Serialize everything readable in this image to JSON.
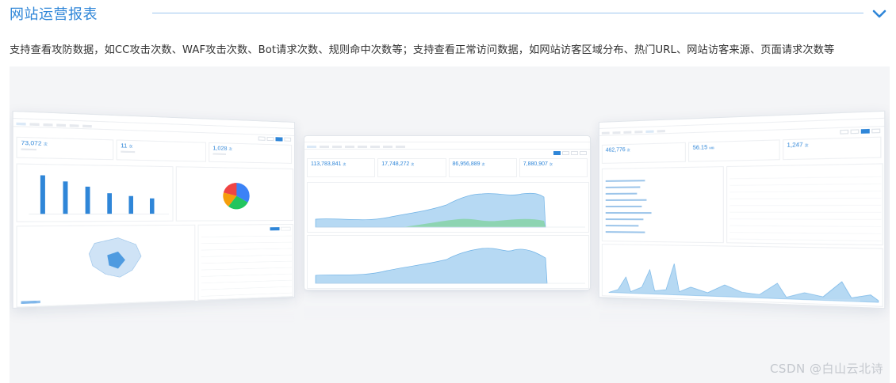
{
  "section": {
    "title": "网站运营报表",
    "description": "支持查看攻防数据，如CC攻击次数、WAF攻击次数、Bot请求次数、规则命中次数等；支持查看正常访问数据，如网站访客区域分布、热门URL、网站访客来源、页面请求次数等",
    "collapse_icon": "chevron-down-icon"
  },
  "left_card": {
    "stats": [
      {
        "value": "73,072",
        "unit": "次"
      },
      {
        "value": "11",
        "unit": "次"
      },
      {
        "value": "1,028",
        "unit": "次"
      }
    ],
    "bar_values": [
      100,
      85,
      72,
      55,
      48,
      42
    ]
  },
  "center_card": {
    "stats": [
      {
        "value": "113,783,841",
        "unit": "次"
      },
      {
        "value": "17,748,272",
        "unit": "次"
      },
      {
        "value": "86,956,889",
        "unit": "次"
      },
      {
        "value": "7,880,907",
        "unit": "次"
      }
    ]
  },
  "right_card": {
    "stats": [
      {
        "value": "462,776",
        "unit": "次"
      },
      {
        "value": "56.15",
        "unit": "MB"
      },
      {
        "value": "1,247",
        "unit": "次"
      }
    ]
  },
  "watermark": "CSDN @白山云北诗",
  "colors": {
    "accent": "#2f86d8",
    "area_blue": "#a8d1f0",
    "area_green": "#7fd0a9",
    "background": "#f4f5f7"
  }
}
